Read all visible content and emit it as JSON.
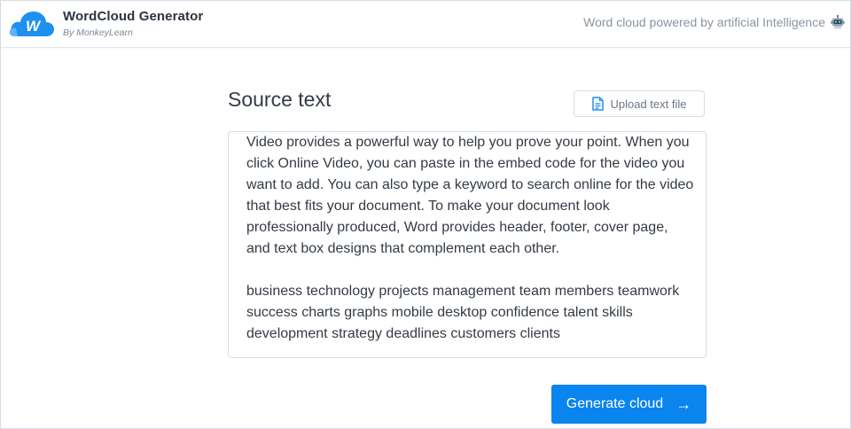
{
  "header": {
    "brand_title": "WordCloud Generator",
    "brand_subtitle": "By MonkeyLearn",
    "tagline": "Word cloud powered by artificial Intelligence",
    "logo_letter": "W",
    "robot_icon": "robot-icon"
  },
  "main": {
    "source_title": "Source text",
    "upload_label": "Upload text file",
    "source_text": "Video provides a powerful way to help you prove your point. When you click Online Video, you can paste in the embed code for the video you want to add. You can also type a keyword to search online for the video that best fits your document. To make your document look professionally produced, Word provides header, footer, cover page, and text box designs that complement each other.\n\nbusiness technology projects management team members teamwork success charts graphs mobile desktop confidence talent skills development strategy deadlines customers clients",
    "generate_label": "Generate cloud",
    "generate_arrow": "→"
  },
  "colors": {
    "accent": "#0a84ee",
    "logo_blue": "#1e90f0",
    "text_dark": "#343b45",
    "text_muted": "#8a94a0"
  }
}
